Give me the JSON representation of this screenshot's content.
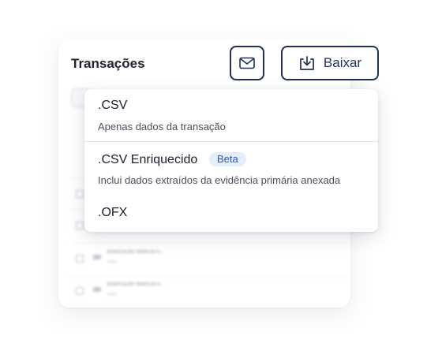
{
  "header": {
    "title": "Transações",
    "email_icon": "envelope-icon",
    "download_icon": "download-tray-icon",
    "download_label": "Baixar"
  },
  "background_list": {
    "rows": [
      {
        "title": "",
        "subtitle": ""
      },
      {
        "title": "",
        "subtitle": ""
      },
      {
        "title": "BONIFICAÇÃO TARIFA DE FL...",
        "subtitle": "Gorus"
      },
      {
        "title": "BONIFICAÇÃO TARIFA DE FL...",
        "subtitle": "Gorus"
      }
    ]
  },
  "export_menu": {
    "options": [
      {
        "title": ".CSV",
        "description": "Apenas dados da transação"
      },
      {
        "title": ".CSV Enriquecido",
        "badge": "Beta",
        "description": "Inclui dados extraídos da evidência primária anexada"
      },
      {
        "title": ".OFX"
      }
    ]
  },
  "colors": {
    "primary": "#223054",
    "badge_bg": "#e3edfb",
    "badge_text": "#2b5bb0"
  }
}
